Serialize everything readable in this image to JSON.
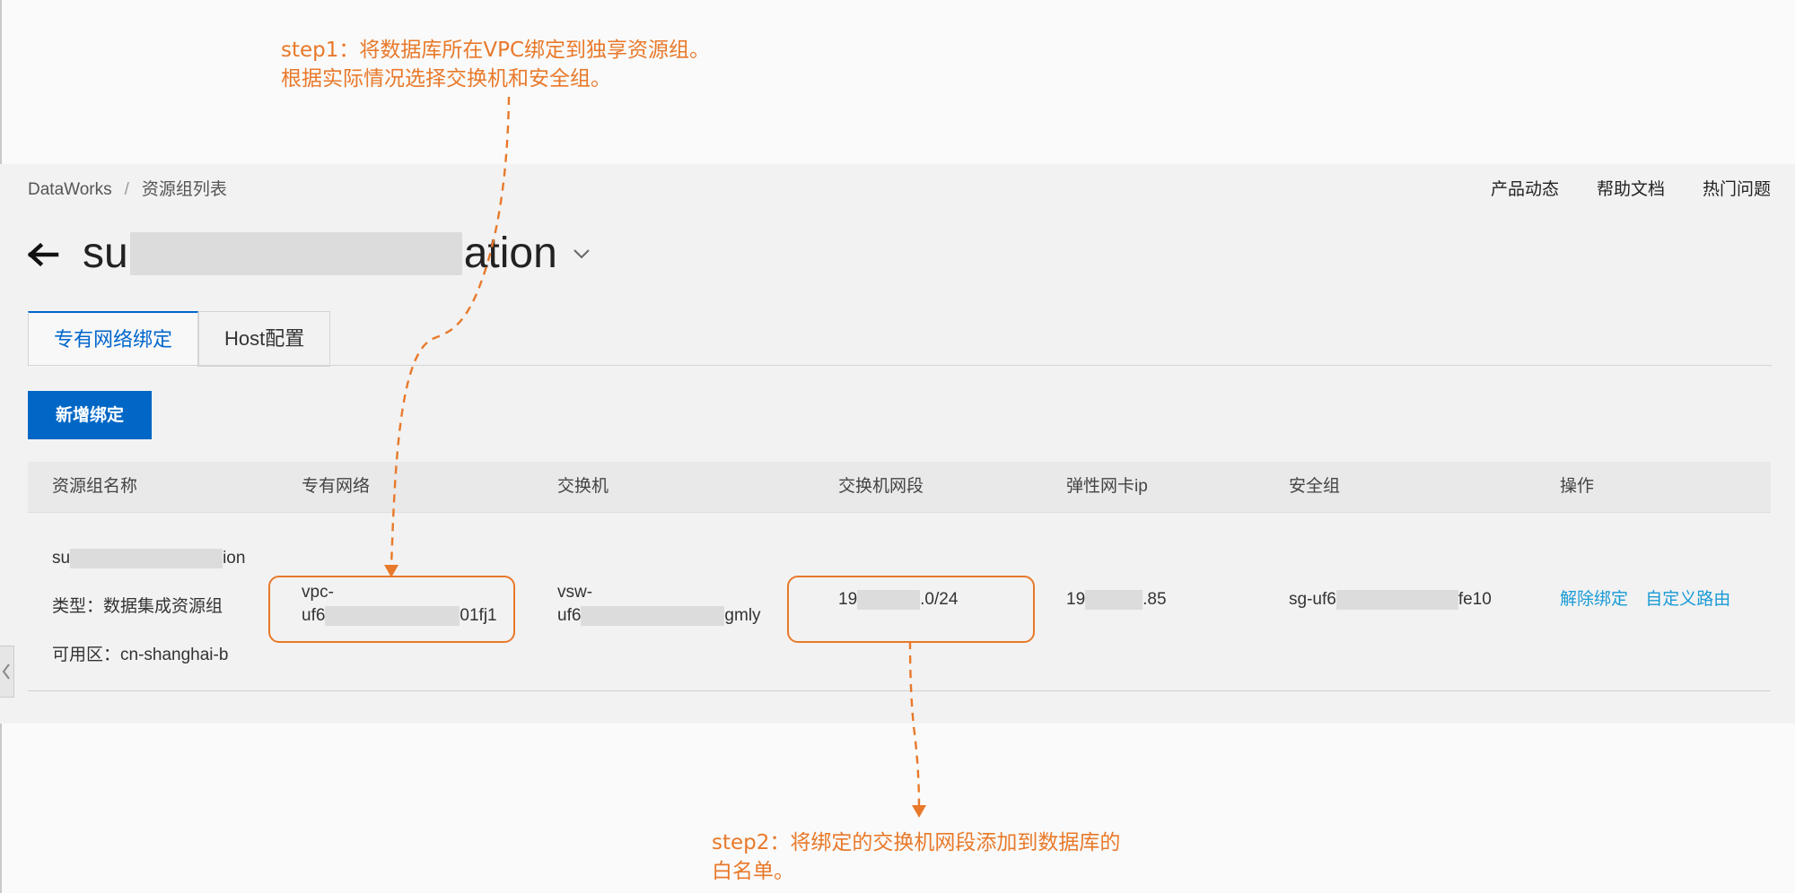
{
  "annotations": {
    "step1_line1": "step1：将数据库所在VPC绑定到独享资源组。",
    "step1_line2": "根据实际情况选择交换机和安全组。",
    "step2_line1": "step2：将绑定的交换机网段添加到数据库的",
    "step2_line2": "白名单。",
    "color": "#e8792a"
  },
  "breadcrumb": {
    "root": "DataWorks",
    "sep": "/",
    "current": "资源组列表"
  },
  "top_links": [
    "产品动态",
    "帮助文档",
    "热门问题"
  ],
  "header": {
    "title_start": "su",
    "title_end": "ation"
  },
  "tabs": [
    {
      "label": "专有网络绑定",
      "active": true
    },
    {
      "label": "Host配置",
      "active": false
    }
  ],
  "add_button": "新增绑定",
  "table": {
    "columns": [
      "资源组名称",
      "专有网络",
      "交换机",
      "交换机网段",
      "弹性网卡ip",
      "安全组",
      "操作"
    ],
    "row": {
      "name_start": "su",
      "name_end": "ion",
      "type": "类型：数据集成资源组",
      "zone": "可用区：cn-shanghai-b",
      "vpc_line1": "vpc-",
      "vpc_line2_start": "uf6",
      "vpc_line2_end": "01fj1",
      "vsw_line1": "vsw-",
      "vsw_line2_start": "uf6",
      "vsw_line2_end": "gmly",
      "cidr_start": "19",
      "cidr_end": ".0/24",
      "eni_start": "19",
      "eni_end": ".85",
      "sg_start": "sg-uf6",
      "sg_end": "fe10",
      "action_unbind": "解除绑定",
      "action_route": "自定义路由"
    }
  },
  "colors": {
    "primary": "#0067c6",
    "link": "#1a9bd6",
    "annotation": "#e8792a"
  }
}
